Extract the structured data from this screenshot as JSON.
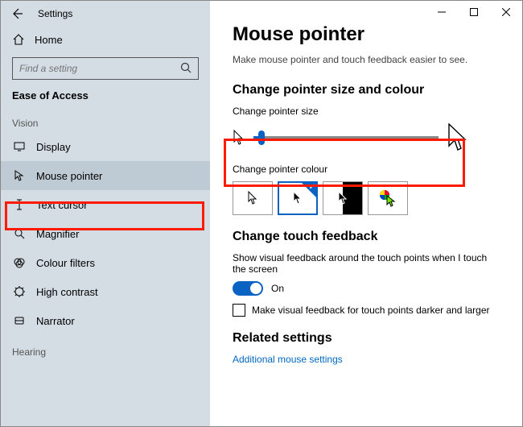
{
  "app": {
    "title": "Settings"
  },
  "search": {
    "placeholder": "Find a setting"
  },
  "section": "Ease of Access",
  "group_vision": "Vision",
  "group_hearing": "Hearing",
  "nav": {
    "home": "Home",
    "items": [
      {
        "label": "Display"
      },
      {
        "label": "Mouse pointer"
      },
      {
        "label": "Text cursor"
      },
      {
        "label": "Magnifier"
      },
      {
        "label": "Colour filters"
      },
      {
        "label": "High contrast"
      },
      {
        "label": "Narrator"
      }
    ]
  },
  "main": {
    "title": "Mouse pointer",
    "subtitle": "Make mouse pointer and touch feedback easier to see.",
    "h_size": "Change pointer size and colour",
    "lbl_size": "Change pointer size",
    "lbl_colour": "Change pointer colour",
    "h_touch": "Change touch feedback",
    "touch_desc": "Show visual feedback around the touch points when I touch the screen",
    "toggle_on": "On",
    "chk_label": "Make visual feedback for touch points darker and larger",
    "h_related": "Related settings",
    "link1": "Additional mouse settings"
  }
}
